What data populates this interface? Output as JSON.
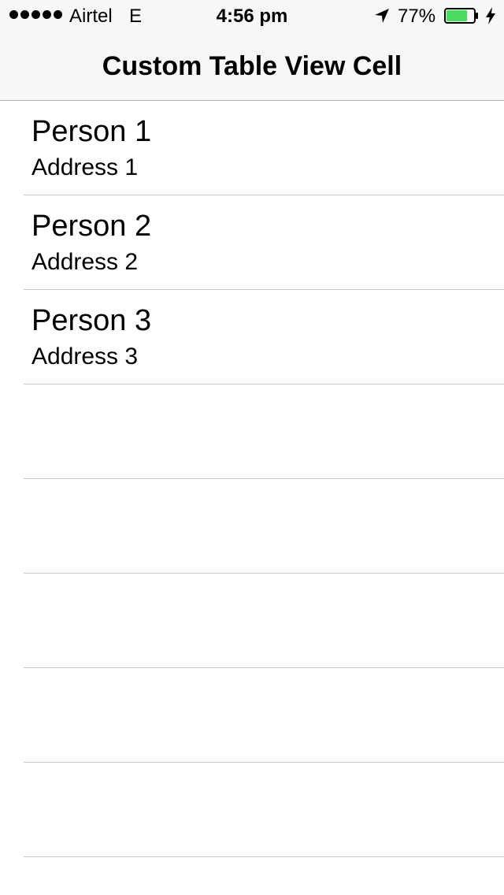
{
  "status_bar": {
    "carrier": "Airtel",
    "network": "E",
    "time": "4:56 pm",
    "battery_percent": "77%",
    "battery_level": 0.77,
    "battery_color": "#4cd964",
    "signal_bars": 5,
    "icons": [
      "signal-icon",
      "location-arrow-icon",
      "battery-icon",
      "charging-bolt-icon"
    ]
  },
  "nav_bar": {
    "title": "Custom Table View Cell"
  },
  "table": {
    "rows": [
      {
        "name": "Person 1",
        "address": "Address 1"
      },
      {
        "name": "Person 2",
        "address": "Address 2"
      },
      {
        "name": "Person 3",
        "address": "Address 3"
      }
    ],
    "empty_rows": 5
  },
  "colors": {
    "nav_background": "#f7f7f7",
    "separator": "#c8c7cc"
  }
}
